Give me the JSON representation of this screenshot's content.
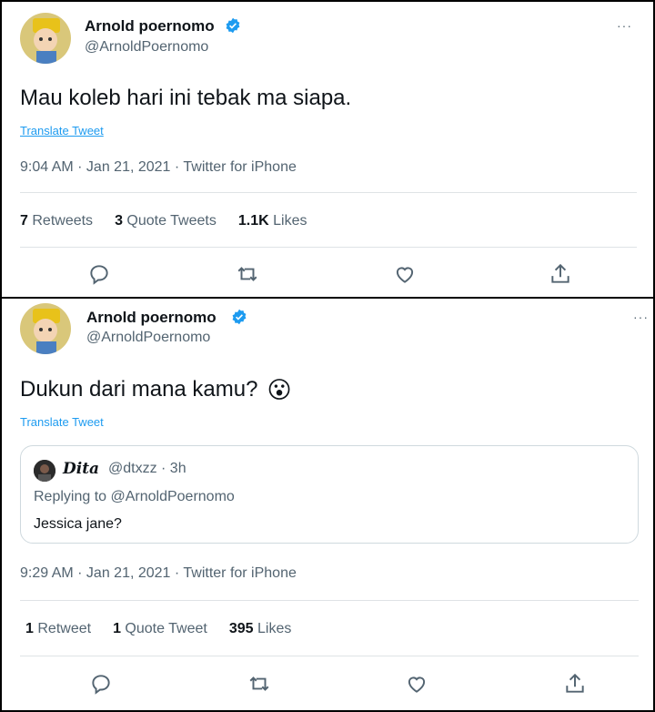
{
  "tweets": [
    {
      "author_name": "Arnold poernomo",
      "author_handle": "@ArnoldPoernomo",
      "more_label": "···",
      "text": "Mau koleb hari ini tebak ma siapa.",
      "translate_label": "Translate Tweet",
      "meta": "9:04 AM · Jan 21, 2021 · Twitter for iPhone",
      "stats": [
        {
          "count": "7",
          "label": "Retweets"
        },
        {
          "count": "3",
          "label": "Quote Tweets"
        },
        {
          "count": "1.1K",
          "label": "Likes"
        }
      ]
    },
    {
      "author_name": "Arnold poernomo",
      "author_handle": "@ArnoldPoernomo",
      "more_label": "···",
      "text": "Dukun dari mana kamu?",
      "emoji": "😮",
      "translate_label": "Translate Tweet",
      "quoted": {
        "name": "Dita",
        "handle_time": "@dtxzz · 3h",
        "replying_to": "Replying to @ArnoldPoernomo",
        "text": "Jessica jane?"
      },
      "meta": "9:29 AM · Jan 21, 2021 · Twitter for iPhone",
      "stats": [
        {
          "count": "1",
          "label": "Retweet"
        },
        {
          "count": "1",
          "label": "Quote Tweet"
        },
        {
          "count": "395",
          "label": "Likes"
        }
      ]
    }
  ],
  "colors": {
    "verified": "#1d9bf0",
    "link": "#1d9bf0",
    "secondary_text": "#536471",
    "primary_text": "#0f1419",
    "divider": "#dfe3e6"
  },
  "icons": [
    "reply-icon",
    "retweet-icon",
    "like-icon",
    "share-icon",
    "verified-badge-icon",
    "more-icon"
  ]
}
